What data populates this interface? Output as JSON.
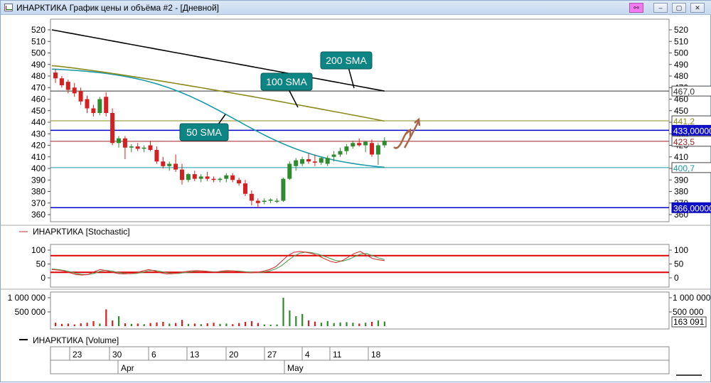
{
  "window": {
    "title": "ИНАРКТИКА График цены и объёма #2 - [Дневной]",
    "buttons": {
      "link": "⚯",
      "minimize": "–",
      "maximize": "▢",
      "close": "✕"
    }
  },
  "colors": {
    "up": "#2e8b2e",
    "down": "#d42020",
    "sma50": "#1a9aa8",
    "sma100": "#8a8a1e",
    "sma200": "#000000",
    "support": "#0000ff",
    "stoch_k": "#d03030",
    "stoch_d": "#50a050",
    "stoch_band": "#dd0000",
    "callout": "#0e8585",
    "arrow": "#a86848"
  },
  "chart_data": [
    {
      "type": "candlestick",
      "title": "ИНАРКТИКА График цены и объёма #2 - [Дневной]",
      "ylim": [
        356,
        525
      ],
      "yticks": [
        "520",
        "510",
        "500",
        "490",
        "480",
        "470",
        "460",
        "450",
        "440",
        "430",
        "420",
        "410",
        "400",
        "390",
        "380",
        "370",
        "360"
      ],
      "candles": [
        {
          "o": 483,
          "h": 486,
          "l": 474,
          "c": 478
        },
        {
          "o": 478,
          "h": 480,
          "l": 470,
          "c": 472
        },
        {
          "o": 475,
          "h": 477,
          "l": 465,
          "c": 468
        },
        {
          "o": 470,
          "h": 474,
          "l": 462,
          "c": 465
        },
        {
          "o": 467,
          "h": 470,
          "l": 455,
          "c": 458
        },
        {
          "o": 460,
          "h": 463,
          "l": 448,
          "c": 452
        },
        {
          "o": 452,
          "h": 455,
          "l": 445,
          "c": 448
        },
        {
          "o": 448,
          "h": 462,
          "l": 446,
          "c": 460
        },
        {
          "o": 462,
          "h": 466,
          "l": 445,
          "c": 448
        },
        {
          "o": 448,
          "h": 452,
          "l": 420,
          "c": 422
        },
        {
          "o": 422,
          "h": 428,
          "l": 418,
          "c": 426
        },
        {
          "o": 426,
          "h": 428,
          "l": 408,
          "c": 418
        },
        {
          "o": 418,
          "h": 421,
          "l": 414,
          "c": 419
        },
        {
          "o": 419,
          "h": 422,
          "l": 415,
          "c": 417
        },
        {
          "o": 417,
          "h": 420,
          "l": 414,
          "c": 418
        },
        {
          "o": 420,
          "h": 424,
          "l": 415,
          "c": 416
        },
        {
          "o": 416,
          "h": 419,
          "l": 404,
          "c": 406
        },
        {
          "o": 406,
          "h": 410,
          "l": 400,
          "c": 402
        },
        {
          "o": 402,
          "h": 406,
          "l": 398,
          "c": 404
        },
        {
          "o": 404,
          "h": 412,
          "l": 397,
          "c": 399
        },
        {
          "o": 399,
          "h": 404,
          "l": 386,
          "c": 390
        },
        {
          "o": 390,
          "h": 396,
          "l": 388,
          "c": 395
        },
        {
          "o": 395,
          "h": 398,
          "l": 389,
          "c": 391
        },
        {
          "o": 391,
          "h": 395,
          "l": 388,
          "c": 393
        },
        {
          "o": 393,
          "h": 397,
          "l": 389,
          "c": 391
        },
        {
          "o": 391,
          "h": 393,
          "l": 388,
          "c": 390
        },
        {
          "o": 390,
          "h": 392,
          "l": 388,
          "c": 391
        },
        {
          "o": 391,
          "h": 396,
          "l": 388,
          "c": 394
        },
        {
          "o": 394,
          "h": 396,
          "l": 388,
          "c": 390
        },
        {
          "o": 390,
          "h": 392,
          "l": 385,
          "c": 387
        },
        {
          "o": 387,
          "h": 390,
          "l": 376,
          "c": 378
        },
        {
          "o": 378,
          "h": 381,
          "l": 368,
          "c": 372
        },
        {
          "o": 372,
          "h": 374,
          "l": 366,
          "c": 370
        },
        {
          "o": 371,
          "h": 374,
          "l": 369,
          "c": 372
        },
        {
          "o": 372,
          "h": 374,
          "l": 370,
          "c": 373
        },
        {
          "o": 372,
          "h": 374,
          "l": 370,
          "c": 372
        },
        {
          "o": 372,
          "h": 392,
          "l": 371,
          "c": 391
        },
        {
          "o": 391,
          "h": 406,
          "l": 390,
          "c": 404
        },
        {
          "o": 402,
          "h": 409,
          "l": 398,
          "c": 407
        },
        {
          "o": 404,
          "h": 410,
          "l": 402,
          "c": 408
        },
        {
          "o": 408,
          "h": 413,
          "l": 404,
          "c": 406
        },
        {
          "o": 406,
          "h": 412,
          "l": 402,
          "c": 405
        },
        {
          "o": 405,
          "h": 410,
          "l": 403,
          "c": 409
        },
        {
          "o": 404,
          "h": 411,
          "l": 402,
          "c": 409
        },
        {
          "o": 410,
          "h": 415,
          "l": 406,
          "c": 412
        },
        {
          "o": 412,
          "h": 418,
          "l": 410,
          "c": 415
        },
        {
          "o": 415,
          "h": 421,
          "l": 412,
          "c": 419
        },
        {
          "o": 419,
          "h": 424,
          "l": 417,
          "c": 422
        },
        {
          "o": 422,
          "h": 426,
          "l": 419,
          "c": 420
        },
        {
          "o": 420,
          "h": 424,
          "l": 414,
          "c": 423
        },
        {
          "o": 422,
          "h": 425,
          "l": 410,
          "c": 412
        },
        {
          "o": 412,
          "h": 422,
          "l": 403,
          "c": 420
        },
        {
          "o": 420,
          "h": 427,
          "l": 418,
          "c": 424
        }
      ],
      "sma": [
        {
          "name": "50 SMA",
          "start": 486,
          "end": 401
        },
        {
          "name": "100 SMA",
          "start": 489,
          "end": 441
        },
        {
          "name": "200 SMA",
          "start": 520,
          "end": 467
        }
      ],
      "hlines": [
        {
          "value": 467.0,
          "label": "467,0",
          "color": "#333333"
        },
        {
          "value": 441.2,
          "label": "441,2",
          "color": "#8a8a1e"
        },
        {
          "value": 433.0,
          "label": "433,00000",
          "color": "#0000cc",
          "highlight": true
        },
        {
          "value": 423.5,
          "label": "423,5",
          "color": "#a02020"
        },
        {
          "value": 400.7,
          "label": "400,7",
          "color": "#1a9aa8"
        },
        {
          "value": 366.0,
          "label": "366,00000",
          "color": "#0000cc",
          "highlight": true
        }
      ],
      "callouts": [
        "200 SMA",
        "100 SMA",
        "50 SMA"
      ]
    },
    {
      "type": "line",
      "title": "ИНАРКТИКА [Stochastic]",
      "ylim": [
        -10,
        110
      ],
      "yticks": [
        "100",
        "50",
        "0"
      ],
      "bands": [
        80,
        20
      ],
      "k": [
        30,
        28,
        25,
        18,
        12,
        10,
        12,
        22,
        30,
        26,
        20,
        15,
        14,
        16,
        18,
        25,
        30,
        25,
        18,
        14,
        15,
        18,
        22,
        25,
        26,
        24,
        22,
        20,
        24,
        26,
        25,
        22,
        20,
        18,
        20,
        24,
        30,
        40,
        60,
        80,
        92,
        95,
        92,
        88,
        80,
        70,
        60,
        55,
        62,
        75,
        88,
        95,
        82,
        70,
        65,
        62
      ],
      "d": [
        32,
        30,
        27,
        22,
        16,
        12,
        12,
        16,
        24,
        27,
        24,
        19,
        16,
        15,
        16,
        20,
        26,
        27,
        23,
        18,
        16,
        16,
        19,
        22,
        24,
        25,
        23,
        21,
        22,
        24,
        25,
        24,
        22,
        20,
        19,
        21,
        25,
        32,
        44,
        62,
        78,
        89,
        93,
        91,
        86,
        78,
        70,
        62,
        60,
        66,
        76,
        86,
        88,
        80,
        72,
        66
      ]
    },
    {
      "type": "bar",
      "title": "ИНАРКТИКА [Volume]",
      "ylim": [
        0,
        1050000
      ],
      "yticks": [
        "1 000 000",
        "500 000"
      ],
      "last_value": "163 091",
      "values": [
        120000,
        80000,
        90000,
        60000,
        100000,
        120000,
        180000,
        90000,
        590000,
        200000,
        350000,
        100000,
        80000,
        90000,
        70000,
        110000,
        130000,
        150000,
        90000,
        110000,
        220000,
        80000,
        90000,
        70000,
        100000,
        120000,
        80000,
        90000,
        70000,
        110000,
        150000,
        180000,
        110000,
        60000,
        50000,
        60000,
        1000000,
        550000,
        350000,
        430000,
        200000,
        160000,
        120000,
        180000,
        110000,
        130000,
        140000,
        120000,
        90000,
        120000,
        150000,
        200000,
        163091
      ],
      "dirs": [
        "d",
        "d",
        "d",
        "d",
        "d",
        "d",
        "d",
        "u",
        "d",
        "d",
        "u",
        "d",
        "u",
        "d",
        "u",
        "d",
        "d",
        "d",
        "u",
        "d",
        "d",
        "u",
        "d",
        "u",
        "d",
        "d",
        "u",
        "u",
        "d",
        "d",
        "d",
        "d",
        "d",
        "u",
        "u",
        "u",
        "u",
        "u",
        "u",
        "u",
        "d",
        "d",
        "u",
        "u",
        "u",
        "u",
        "u",
        "u",
        "d",
        "u",
        "d",
        "u",
        "u"
      ]
    }
  ],
  "xaxis": {
    "days": [
      {
        "label": "23",
        "index": 4
      },
      {
        "label": "30",
        "index": 9
      },
      {
        "label": "6",
        "index": 14
      },
      {
        "label": "13",
        "index": 19
      },
      {
        "label": "20",
        "index": 24
      },
      {
        "label": "27",
        "index": 29
      },
      {
        "label": "4",
        "index": 34
      },
      {
        "label": "11",
        "index": 39
      },
      {
        "label": "18",
        "index": 44
      }
    ],
    "months": [
      {
        "label": "Apr",
        "index": 9
      },
      {
        "label": "May",
        "index": 33
      }
    ]
  }
}
